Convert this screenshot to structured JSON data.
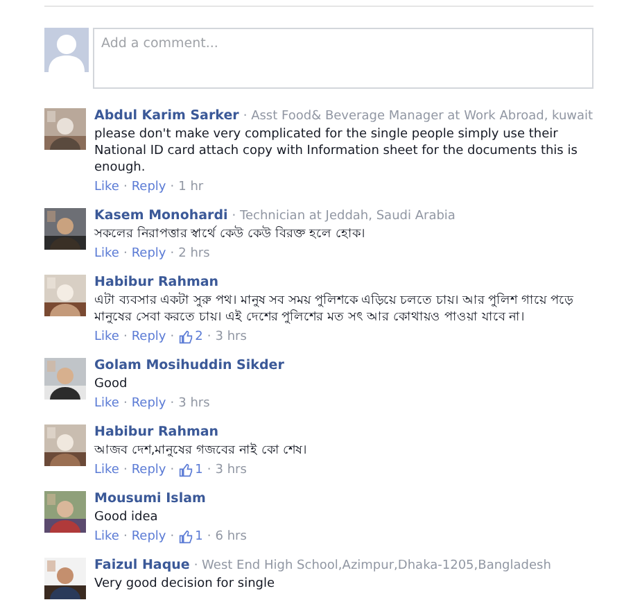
{
  "comment_box": {
    "placeholder": "Add a comment..."
  },
  "comments": [
    {
      "name": "Abdul Karim Sarker",
      "headline": "· Asst Food& Beverage Manager at Work Abroad, kuwait",
      "text": "please don't make very complicated for the single people simply use their National ID card attach copy with Information sheet for the documents this is enough.",
      "actions": [
        {
          "kind": "link",
          "text": "Like"
        },
        {
          "kind": "sep",
          "text": "·"
        },
        {
          "kind": "link",
          "text": "Reply"
        },
        {
          "kind": "sep",
          "text": "·"
        },
        {
          "kind": "time",
          "text": "1 hr"
        }
      ]
    },
    {
      "name": "Kasem Monohardi",
      "headline": "· Technician at Jeddah, Saudi Arabia",
      "text": "সকলের নিরাপত্তার স্বার্থে কেউ কেউ বিরক্ত হলে হোক।",
      "actions": [
        {
          "kind": "link",
          "text": "Like"
        },
        {
          "kind": "sep",
          "text": "·"
        },
        {
          "kind": "link",
          "text": "Reply"
        },
        {
          "kind": "sep",
          "text": "·"
        },
        {
          "kind": "time",
          "text": "2 hrs"
        }
      ]
    },
    {
      "name": "Habibur Rahman",
      "text": "এটা ব্যবসার একটা সুরু পথ। মানুষ সব সময় পুলিশকে এড়িয়ে চলতে চায়। আর পুলিশ গায়ে পড়ে মানুষের সেবা করতে চায়। এই দেশের পুলিশের মত সৎ আর কোথায়ও পাওয়া যাবে না।",
      "actions": [
        {
          "kind": "link",
          "text": "Like"
        },
        {
          "kind": "sep",
          "text": "·"
        },
        {
          "kind": "link",
          "text": "Reply"
        },
        {
          "kind": "sep",
          "text": "·"
        },
        {
          "kind": "likes",
          "text": "2"
        },
        {
          "kind": "sep",
          "text": "·"
        },
        {
          "kind": "time",
          "text": "3 hrs"
        }
      ]
    },
    {
      "name": "Golam Mosihuddin Sikder",
      "text": "Good",
      "actions": [
        {
          "kind": "link",
          "text": "Like"
        },
        {
          "kind": "sep",
          "text": "·"
        },
        {
          "kind": "link",
          "text": "Reply"
        },
        {
          "kind": "sep",
          "text": "·"
        },
        {
          "kind": "time",
          "text": "3 hrs"
        }
      ]
    },
    {
      "name": "Habibur Rahman",
      "text": "আজব দেশ,মানুষের গজবের নাই কো শেষ।",
      "actions": [
        {
          "kind": "link",
          "text": "Like"
        },
        {
          "kind": "sep",
          "text": "·"
        },
        {
          "kind": "link",
          "text": "Reply"
        },
        {
          "kind": "sep",
          "text": "·"
        },
        {
          "kind": "likes",
          "text": "1"
        },
        {
          "kind": "sep",
          "text": "·"
        },
        {
          "kind": "time",
          "text": "3 hrs"
        }
      ]
    },
    {
      "name": "Mousumi Islam",
      "text": "Good idea",
      "actions": [
        {
          "kind": "link",
          "text": "Like"
        },
        {
          "kind": "sep",
          "text": "·"
        },
        {
          "kind": "link",
          "text": "Reply"
        },
        {
          "kind": "sep",
          "text": "·"
        },
        {
          "kind": "likes",
          "text": "1"
        },
        {
          "kind": "sep",
          "text": "·"
        },
        {
          "kind": "time",
          "text": "6 hrs"
        }
      ]
    },
    {
      "name": "Faizul Haque",
      "headline": "· West End High School,Azimpur,Dhaka-1205,Bangladesh",
      "text": "Very good decision for single"
    }
  ]
}
